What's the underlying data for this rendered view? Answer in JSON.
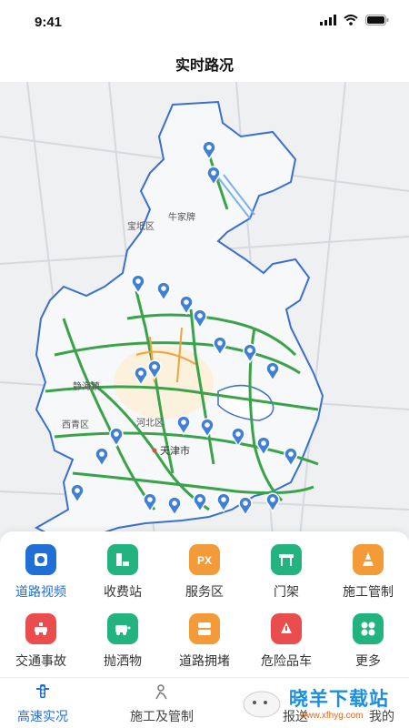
{
  "status": {
    "time": "9:41"
  },
  "header": {
    "title": "实时路况"
  },
  "map": {
    "labels": {
      "tianjin": "天津市",
      "xiqing": "西青区",
      "hebei": "河北区",
      "qingcheng": "静海镇",
      "niujiapai": "牛家牌",
      "baodi": "宝坻区"
    }
  },
  "services": [
    {
      "label": "道路视频",
      "icon": "road-video-icon",
      "color": "#1f6fd6",
      "active": true
    },
    {
      "label": "收费站",
      "icon": "toll-station-icon",
      "color": "#22b37e"
    },
    {
      "label": "服务区",
      "icon": "service-area-icon",
      "color": "#f39b38"
    },
    {
      "label": "门架",
      "icon": "gantry-icon",
      "color": "#22b37e"
    },
    {
      "label": "施工管制",
      "icon": "construction-cone-icon",
      "color": "#f39b38"
    },
    {
      "label": "交通事故",
      "icon": "traffic-accident-icon",
      "color": "#ea4d4d"
    },
    {
      "label": "抛洒物",
      "icon": "spilled-object-icon",
      "color": "#22b37e"
    },
    {
      "label": "道路拥堵",
      "icon": "road-congestion-icon",
      "color": "#f39b38"
    },
    {
      "label": "危险品车",
      "icon": "hazmat-truck-icon",
      "color": "#ea4d4d"
    },
    {
      "label": "更多",
      "icon": "more-icon",
      "color": "#22b37e"
    }
  ],
  "tabs": [
    {
      "label": "高速实况",
      "active": true
    },
    {
      "label": "施工及管制"
    },
    {
      "label": "报送"
    },
    {
      "label": "我的"
    }
  ],
  "watermark": {
    "text": "晓羊下载站",
    "url": "www.xfhyg.com"
  }
}
